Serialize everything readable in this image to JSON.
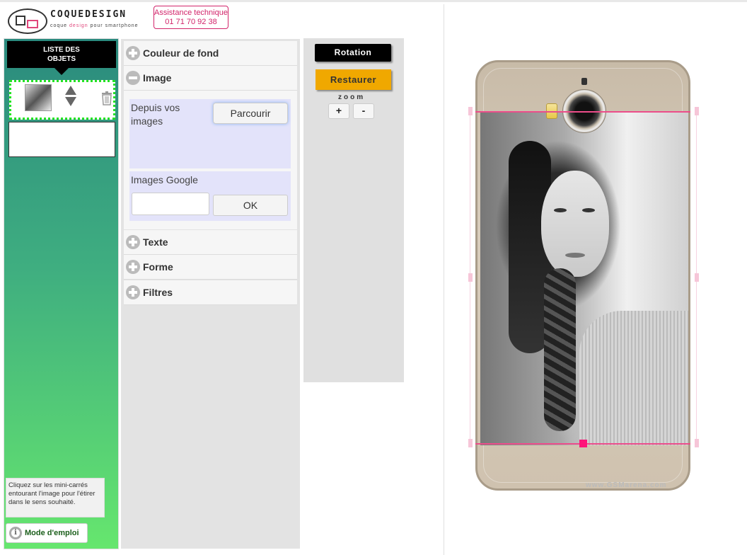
{
  "header": {
    "logo_text": "COQUEDESIGN",
    "logo_sub_1": "coque ",
    "logo_sub_pink": "design",
    "logo_sub_2": " pour smartphone",
    "assist_line1": "Assistance technique",
    "assist_line2": "01 71 70 92 38"
  },
  "left": {
    "title_line1": "LISTE DES",
    "title_line2": "OBJETS",
    "hint": "Cliquez sur les mini-carrés entourant l'image pour l'étirer dans le sens souhaité.",
    "mode_label": "Mode d'emploi",
    "info_glyph": "i"
  },
  "middle": {
    "couleur": "Couleur de fond",
    "image": "Image",
    "depuis": "Depuis vos images",
    "parcourir": "Parcourir",
    "google": "Images Google",
    "google_value": "",
    "ok": "OK",
    "texte": "Texte",
    "forme": "Forme",
    "filtres": "Filtres"
  },
  "tools": {
    "rotation": "Rotation",
    "restaurer": "Restaurer",
    "zoom": "zoom",
    "zoom_plus": "+",
    "zoom_minus": "-"
  },
  "colors": {
    "accent_pink": "#d2246a",
    "handle_pink": "#ff1479",
    "restaurer_orange": "#f0a800",
    "selection_green": "#23e323"
  },
  "preview": {
    "watermark": "www.GSMarena.com"
  }
}
